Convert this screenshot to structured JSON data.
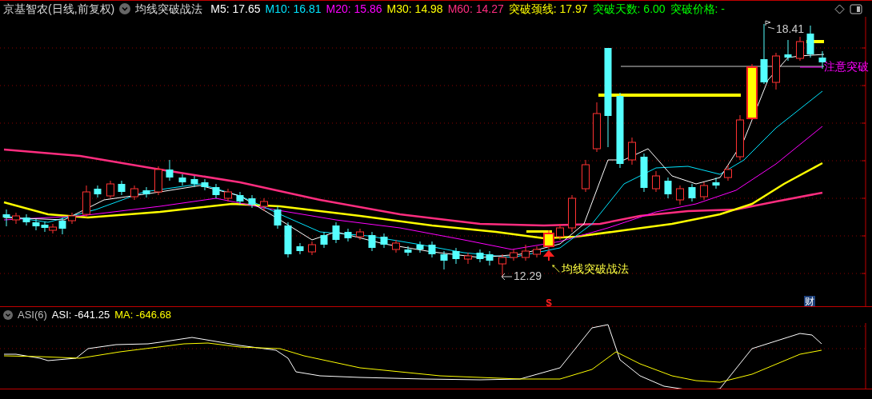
{
  "header": {
    "title": "京基智农(日线,前复权)",
    "indicator": "均线突破战法",
    "values": [
      {
        "text": "M5: 17.65",
        "color": "#ffffff"
      },
      {
        "text": "M10: 16.81",
        "color": "#00e5ff"
      },
      {
        "text": "M20: 15.86",
        "color": "#ff00ff"
      },
      {
        "text": "M30: 14.98",
        "color": "#ffff00"
      },
      {
        "text": "M60: 14.27",
        "color": "#ff2d7f"
      },
      {
        "text": "突破颈线: 17.97",
        "color": "#ffff00"
      },
      {
        "text": "突破天数: 6.00",
        "color": "#00ff00"
      },
      {
        "text": "突破价格: -",
        "color": "#00ff00"
      }
    ]
  },
  "chart": {
    "high_label": "18.41",
    "low_label": "12.29",
    "signal_label": "↖均线突破战法",
    "alert_label": "注意突破",
    "markers": [
      {
        "kind": "dividend",
        "text": "$"
      },
      {
        "kind": "finance",
        "text": "财"
      }
    ]
  },
  "asi": {
    "title": "ASI(6)",
    "values": [
      {
        "text": "ASI: -641.25",
        "color": "#ffffff"
      },
      {
        "text": "MA: -646.68",
        "color": "#ffff00"
      }
    ]
  }
}
